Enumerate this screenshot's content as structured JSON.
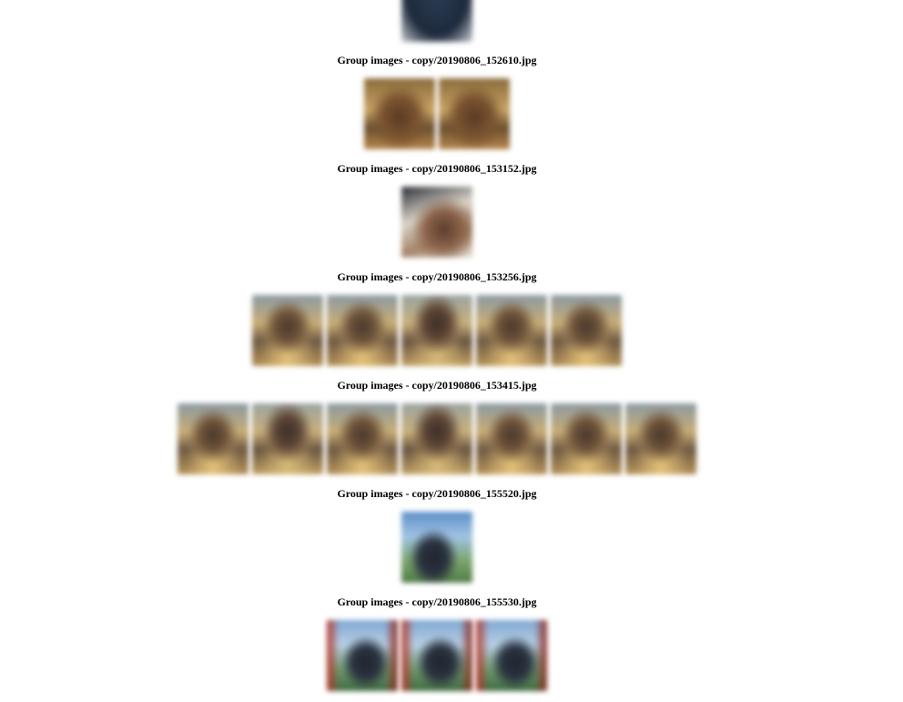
{
  "groups": [
    {
      "caption": "Group images - copy/20190806_152610.jpg",
      "thumbs": [
        "t-table",
        "t-table"
      ]
    },
    {
      "caption": "Group images - copy/20190806_153152.jpg",
      "thumbs": [
        "t-food"
      ]
    },
    {
      "caption": "Group images - copy/20190806_153256.jpg",
      "thumbs": [
        "t-person",
        "t-person",
        "t-person2",
        "t-person",
        "t-person"
      ]
    },
    {
      "caption": "Group images - copy/20190806_153415.jpg",
      "thumbs": [
        "t-person",
        "t-person2",
        "t-person",
        "t-person2",
        "t-person",
        "t-person",
        "t-person"
      ]
    },
    {
      "caption": "Group images - copy/20190806_155520.jpg",
      "thumbs": [
        "t-sky"
      ]
    },
    {
      "caption": "Group images - copy/20190806_155530.jpg",
      "thumbs": [
        "t-sky2",
        "t-sky2",
        "t-sky2"
      ]
    }
  ],
  "top_thumb": "t-dark"
}
